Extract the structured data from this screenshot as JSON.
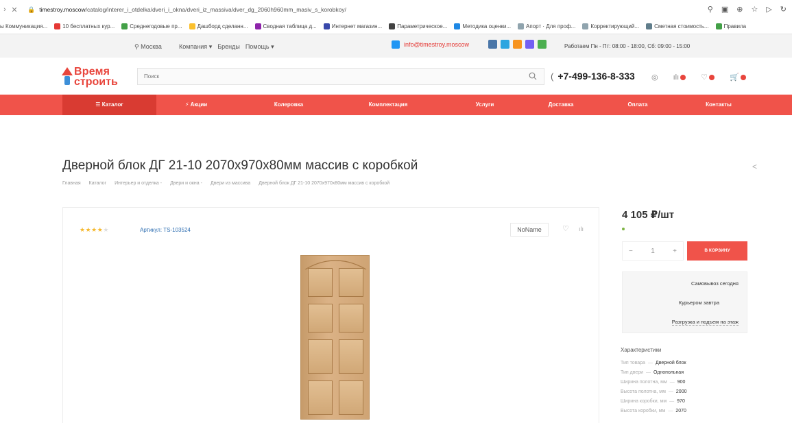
{
  "browser": {
    "url_host": "timestroy.moscow",
    "url_path": "/catalog/interer_i_otdelka/dveri_i_okna/dveri_iz_massiva/dver_dg_2060h960mm_masiv_s_korobkoy/",
    "bookmarks": [
      {
        "label": "ы Коммуникация...",
        "color": "#7a7a7a"
      },
      {
        "label": "10 бесплатных кур...",
        "color": "#e53935"
      },
      {
        "label": "Среднегодовые пр...",
        "color": "#43a047"
      },
      {
        "label": "Дашборд сделанн...",
        "color": "#fbc02d"
      },
      {
        "label": "Сводная таблица д...",
        "color": "#8e24aa"
      },
      {
        "label": "Интернет магазин...",
        "color": "#3949ab"
      },
      {
        "label": "Параметрическое...",
        "color": "#424242"
      },
      {
        "label": "Методика оценки...",
        "color": "#1e88e5"
      },
      {
        "label": "Апорт · Для проф...",
        "color": "#90a4ae"
      },
      {
        "label": "Корректирующий...",
        "color": "#90a4ae"
      },
      {
        "label": "Сметная стоимость...",
        "color": "#607d8b"
      },
      {
        "label": "Правила",
        "color": "#43a047"
      }
    ]
  },
  "topstrip": {
    "city": "Москва",
    "menu": [
      "Компания",
      "Бренды",
      "Помощь"
    ],
    "email": "info@timestroy.moscow",
    "hours": "Работаем Пн - Пт: 08:00 - 18:00, Сб: 09:00 - 15:00",
    "social_colors": [
      "#4a76a8",
      "#2ca5e0",
      "#f7931e",
      "#7360f2",
      "#4caf50"
    ]
  },
  "header": {
    "logo_line1": "Время",
    "logo_line2": "строить",
    "search_placeholder": "Поиск",
    "phone": "+7-499-136-8-333"
  },
  "nav": [
    {
      "label": "☰ Каталог"
    },
    {
      "label": "⚡ Акции"
    },
    {
      "label": "Колеровка"
    },
    {
      "label": "Комплектация"
    },
    {
      "label": "Услуги"
    },
    {
      "label": "Доставка"
    },
    {
      "label": "Оплата"
    },
    {
      "label": "Контакты"
    }
  ],
  "product": {
    "title": "Дверной блок ДГ 21-10 2070x970x80мм массив с коробкой",
    "breadcrumbs": [
      "Главная",
      "Каталог",
      "Интерьер и отделка -",
      "Двери и окна -",
      "Двери из массива",
      "Дверной блок ДГ 21-10 2070х970х80мм массив с коробкой"
    ],
    "rating": 4,
    "sku": "Артикул: TS-103524",
    "brand": "NoName",
    "price": "4 105 ₽/шт",
    "qty": "1",
    "cart_button": "В КОРЗИНУ",
    "delivery": [
      "Самовывоз сегодня",
      "Курьером завтра",
      "Разгрузка и подъем на этаж"
    ],
    "chars_title": "Характеристики",
    "chars": [
      {
        "k": "Тип товара",
        "v": "Дверной блок"
      },
      {
        "k": "Тип двери",
        "v": "Однопольная"
      },
      {
        "k": "Ширина полотна, мм",
        "v": "900"
      },
      {
        "k": "Высота полотна, мм",
        "v": "2000"
      },
      {
        "k": "Ширина коробки, мм",
        "v": "970"
      },
      {
        "k": "Высота коробки, мм",
        "v": "2070"
      }
    ]
  },
  "colors": {
    "brand_red": "#f0534a",
    "active_nav": "#d93b32",
    "link_blue": "#2b6cb0"
  }
}
